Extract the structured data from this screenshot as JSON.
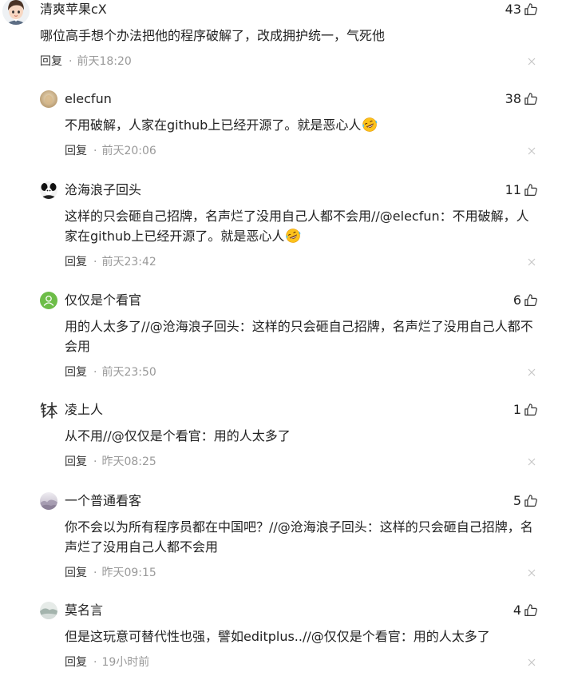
{
  "ui": {
    "separator": "·"
  },
  "icons": {
    "like": "thumbs-up-icon",
    "close": "close-icon"
  },
  "colors": {
    "text": "#222222",
    "secondary": "#999999",
    "reply": "#333333",
    "close": "#c7c7c7",
    "default_avatar": "#6dbd48"
  },
  "comments": [
    {
      "user": "清爽苹果cX",
      "avatar": "cartoon-boy-avatar",
      "likes": 43,
      "text": [
        "哪位高手想个办法把他的程序破解了，改成拥护统一，气死他"
      ],
      "reply_label": "回复",
      "time": "前天18:20"
    },
    {
      "user": "elecfun",
      "avatar": "beige-photo-avatar",
      "likes": 38,
      "text": [
        "不用破解，人家在github上已经开源了。就是恶心人"
      ],
      "trailing_emoji": "rolling-on-floor-laughing-emoji",
      "reply_label": "回复",
      "time": "前天20:06"
    },
    {
      "user": "沧海浪子回头",
      "avatar": "black-white-avatar",
      "likes": 11,
      "text": [
        "这样的只会砸自己招牌，名声烂了没用自己人都不会用//@elecfun：不用破解，人",
        "家在github上已经开源了。就是恶心人"
      ],
      "trailing_emoji": "rolling-on-floor-laughing-emoji",
      "reply_label": "回复",
      "time": "前天23:42"
    },
    {
      "user": "仅仅是个看官",
      "avatar": "default-user-avatar",
      "likes": 6,
      "text": [
        "用的人太多了//@沧海浪子回头：这样的只会砸自己招牌，名声烂了没用自己人都不",
        "会用"
      ],
      "reply_label": "回复",
      "time": "前天23:50"
    },
    {
      "user": "凌上人",
      "avatar": "calligraphy-avatar",
      "likes": 1,
      "text": [
        "从不用//@仅仅是个看官：用的人太多了"
      ],
      "reply_label": "回复",
      "time": "昨天08:25"
    },
    {
      "user": "一个普通看客",
      "avatar": "misty-landscape-avatar",
      "likes": 5,
      "text": [
        "你不会以为所有程序员都在中国吧？//@沧海浪子回头：这样的只会砸自己招牌，名",
        "声烂了没用自己人都不会用"
      ],
      "reply_label": "回复",
      "time": "昨天09:15"
    },
    {
      "user": "莫名言",
      "avatar": "ink-landscape-avatar",
      "likes": 4,
      "text": [
        "但是这玩意可替代性也强，譬如editplus..//@仅仅是个看官：用的人太多了"
      ],
      "reply_label": "回复",
      "time": "19小时前"
    }
  ]
}
